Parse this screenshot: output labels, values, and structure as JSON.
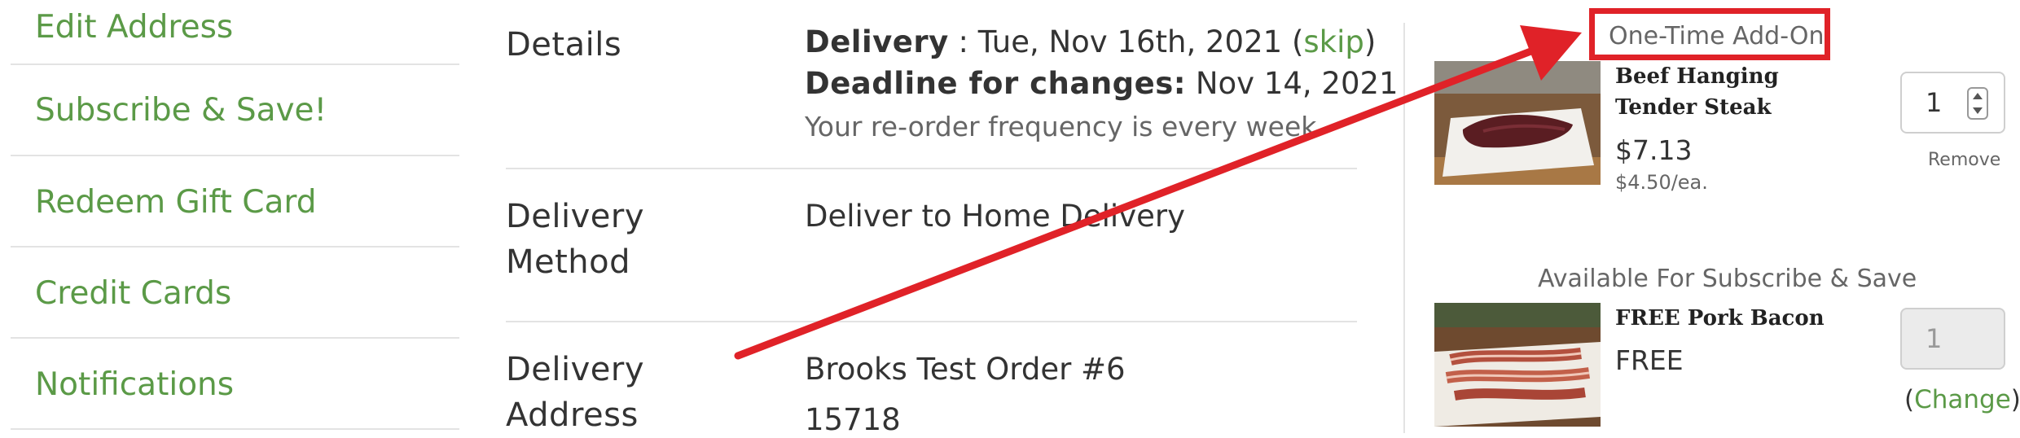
{
  "sidebar": {
    "items": [
      {
        "label": "Edit Address"
      },
      {
        "label": "Subscribe & Save!"
      },
      {
        "label": "Redeem Gift Card"
      },
      {
        "label": "Credit Cards"
      },
      {
        "label": "Notifications"
      }
    ]
  },
  "details": {
    "label": "Details",
    "delivery_label": "Delivery",
    "delivery_sep": " : ",
    "delivery_date": "Tue, Nov 16th, 2021",
    "skip_open": " (",
    "skip_link": "skip",
    "skip_close": ")",
    "deadline_label": "Deadline for changes:",
    "deadline_date": " Nov 14, 2021",
    "frequency": "Your re-order frequency is every week"
  },
  "delivery_method": {
    "label_line1": "Delivery",
    "label_line2": "Method",
    "value": "Deliver to Home Delivery"
  },
  "delivery_address": {
    "label_line1": "Delivery",
    "label_line2": "Address",
    "line1": "Brooks Test Order #6",
    "line2": "15718"
  },
  "addon": {
    "section_title": "One-Time Add-On",
    "product_name": "Beef Hanging Tender Steak",
    "price": "$7.13",
    "unit_price": "$4.50/ea.",
    "quantity": "1",
    "remove_label": "Remove"
  },
  "subscribe": {
    "section_title": "Available For Subscribe & Save",
    "product_name": "FREE Pork Bacon",
    "price": "FREE",
    "quantity": "1",
    "change_open": "(",
    "change_link": "Change",
    "change_close": ")"
  },
  "colors": {
    "link_green": "#5b9a47",
    "highlight_red": "#e02228"
  },
  "icons": {
    "annotation": "red-arrow-icon",
    "stepper": "spinner-arrows-icon"
  }
}
